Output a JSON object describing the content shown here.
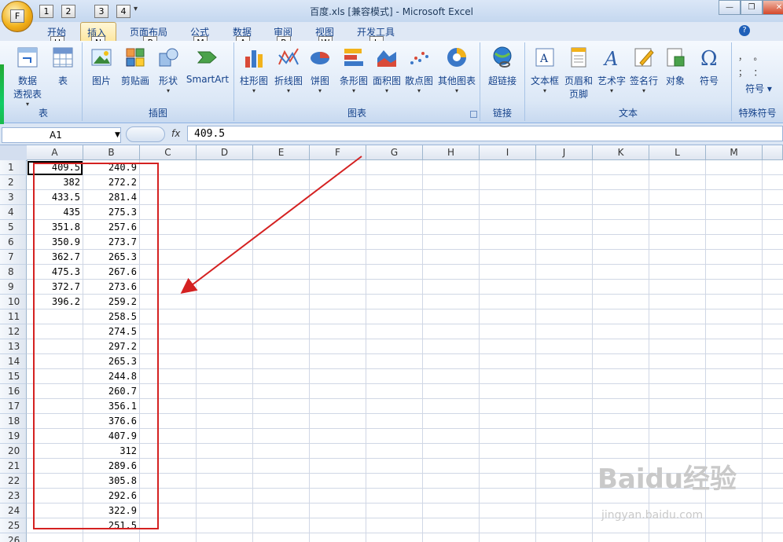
{
  "window": {
    "title": "百度.xls  [兼容模式] - Microsoft Excel",
    "office_key": "F",
    "qat_keys": [
      "1",
      "2",
      "3",
      "4"
    ]
  },
  "tabs": [
    {
      "label": "开始",
      "key": "H"
    },
    {
      "label": "插入",
      "key": "N",
      "active": true
    },
    {
      "label": "页面布局",
      "key": "P"
    },
    {
      "label": "公式",
      "key": "M"
    },
    {
      "label": "数据",
      "key": "A"
    },
    {
      "label": "审阅",
      "key": "R"
    },
    {
      "label": "视图",
      "key": "W"
    },
    {
      "label": "开发工具",
      "key": "L"
    }
  ],
  "ribbon": {
    "groups": [
      {
        "label": "表",
        "commands": [
          "数据\n透视表",
          "表"
        ]
      },
      {
        "label": "插图",
        "commands": [
          "图片",
          "剪贴画",
          "形状",
          "SmartArt"
        ]
      },
      {
        "label": "图表",
        "commands": [
          "柱形图",
          "折线图",
          "饼图",
          "条形图",
          "面积图",
          "散点图",
          "其他图表"
        ]
      },
      {
        "label": "链接",
        "commands": [
          "超链接"
        ]
      },
      {
        "label": "文本",
        "commands": [
          "文本框",
          "页眉和\n页脚",
          "艺术字",
          "签名行",
          "对象",
          "符号"
        ]
      },
      {
        "label": "特殊符号",
        "commands": [
          "符号"
        ]
      }
    ]
  },
  "formula_bar": {
    "name_box": "A1",
    "fx": "fx",
    "value": "409.5"
  },
  "columns": [
    "A",
    "B",
    "C",
    "D",
    "E",
    "F",
    "G",
    "H",
    "I",
    "J",
    "K",
    "L",
    "M"
  ],
  "rows": [
    "1",
    "2",
    "3",
    "4",
    "5",
    "6",
    "7",
    "8",
    "9",
    "10",
    "11",
    "12",
    "13",
    "14",
    "15",
    "16",
    "17",
    "18",
    "19",
    "20",
    "21",
    "22",
    "23",
    "24",
    "25",
    "26"
  ],
  "data": {
    "col_a": [
      "409.5",
      "382",
      "433.5",
      "435",
      "351.8",
      "350.9",
      "362.7",
      "475.3",
      "372.7",
      "396.2"
    ],
    "col_b": [
      "240.9",
      "272.2",
      "281.4",
      "275.3",
      "257.6",
      "273.7",
      "265.3",
      "267.6",
      "273.6",
      "259.2",
      "258.5",
      "274.5",
      "297.2",
      "265.3",
      "244.8",
      "260.7",
      "356.1",
      "376.6",
      "407.9",
      "312",
      "289.6",
      "305.8",
      "292.6",
      "322.9",
      "251.5"
    ]
  },
  "watermark": {
    "brand": "Baidu经验",
    "url": "jingyan.baidu.com"
  },
  "colors": {
    "annotation_red": "#d42121"
  }
}
